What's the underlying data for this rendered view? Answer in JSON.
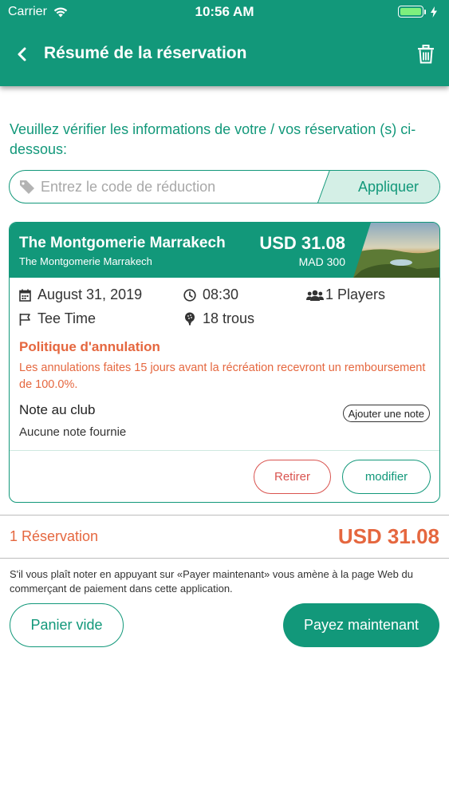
{
  "status_bar": {
    "carrier": "Carrier",
    "time": "10:56 AM",
    "icons": [
      "wifi-icon",
      "battery-icon",
      "charging-icon"
    ]
  },
  "header": {
    "title": "Résumé de la réservation",
    "back_icon": "chevron-left-icon",
    "delete_icon": "trash-icon"
  },
  "intro_text": "Veuillez vérifier les informations de votre / vos réservation (s) ci-dessous:",
  "promo": {
    "placeholder": "Entrez le code de réduction",
    "value": "",
    "apply_label": "Appliquer",
    "icon": "tag-icon"
  },
  "booking": {
    "course_name": "The Montgomerie Marrakech",
    "course_subtitle": "The Montgomerie Marrakech",
    "price_usd": "USD 31.08",
    "price_mad": "MAD 300",
    "date": "August 31, 2019",
    "time": "08:30",
    "players": "1 Players",
    "type": "Tee Time",
    "holes": "18 trous",
    "policy_title": "Politique d'annulation",
    "policy_text": "Les annulations faites 15 jours avant la récréation recevront un remboursement de 100.0%.",
    "note_title": "Note au club",
    "add_note_label": "Ajouter une note",
    "note_text": "Aucune note fournie",
    "remove_label": "Retirer",
    "modify_label": "modifier"
  },
  "summary": {
    "count_label": "1 Réservation",
    "total": "USD 31.08"
  },
  "disclaimer": "S'il vous plaît noter en appuyant sur «Payer maintenant» vous amène à la page Web du commerçant de paiement dans cette application.",
  "actions": {
    "empty_cart_label": "Panier vide",
    "pay_now_label": "Payez maintenant"
  },
  "colors": {
    "primary": "#12987a",
    "accent": "#e5673f",
    "danger": "#d9534f"
  }
}
